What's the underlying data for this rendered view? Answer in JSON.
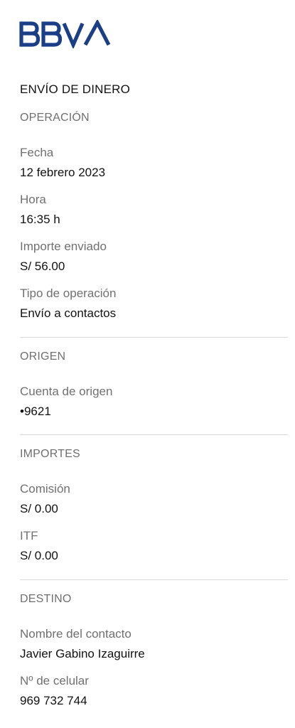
{
  "header": {
    "logo_text": "BBVA",
    "logo_color": "#1b3f87",
    "title": "ENVÍO DE DINERO"
  },
  "operacion": {
    "section_title": "OPERACIÓN",
    "fecha_label": "Fecha",
    "fecha_value": "12 febrero 2023",
    "hora_label": "Hora",
    "hora_value": "16:35 h",
    "importe_label": "Importe enviado",
    "importe_value": "S/ 56.00",
    "tipo_label": "Tipo de operación",
    "tipo_value": "Envío a contactos"
  },
  "origen": {
    "section_title": "ORIGEN",
    "cuenta_label": "Cuenta de origen",
    "cuenta_value": "•9621"
  },
  "importes": {
    "section_title": "IMPORTES",
    "comision_label": "Comisión",
    "comision_value": "S/ 0.00",
    "itf_label": "ITF",
    "itf_value": "S/ 0.00"
  },
  "destino": {
    "section_title": "DESTINO",
    "nombre_label": "Nombre del contacto",
    "nombre_value": "Javier Gabino Izaguirre",
    "celular_label": "Nº de celular",
    "celular_value": "969 732 744"
  }
}
